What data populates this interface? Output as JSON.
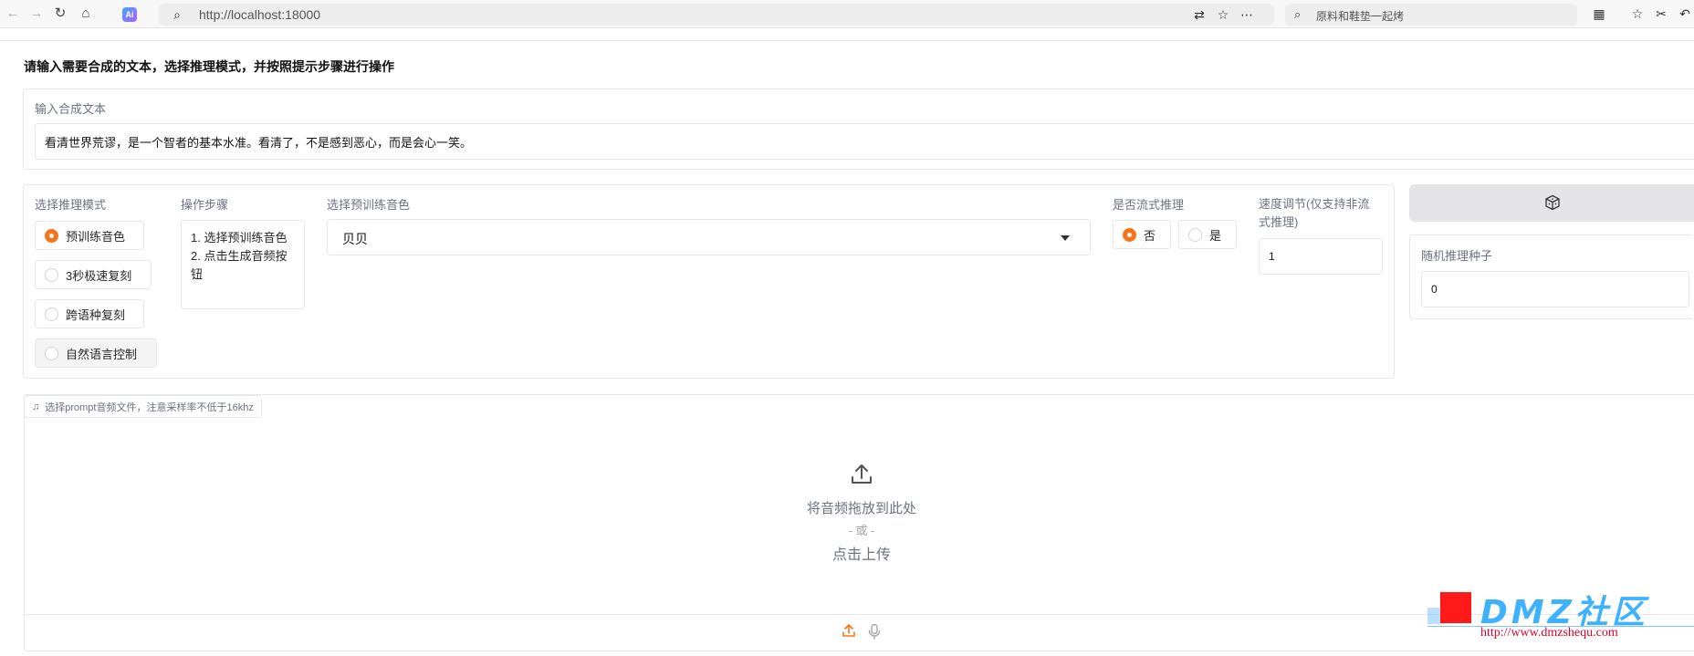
{
  "browser": {
    "url": "http://localhost:18000",
    "search_query": "原料和鞋垫一起烤",
    "ai_badge": "Ai"
  },
  "page": {
    "heading": "请输入需要合成的文本，选择推理模式，并按照提示步骤进行操作"
  },
  "tts_input": {
    "label": "输入合成文本",
    "value": "看清世界荒谬，是一个智者的基本水准。看清了，不是感到恶心，而是会心一笑。"
  },
  "mode": {
    "label": "选择推理模式",
    "options": [
      "预训练音色",
      "3秒极速复刻",
      "跨语种复刻",
      "自然语言控制"
    ],
    "selected": "预训练音色"
  },
  "steps": {
    "label": "操作步骤",
    "lines": [
      "1. 选择预训练音色",
      "2. 点击生成音频按",
      "钮"
    ]
  },
  "voice": {
    "label": "选择预训练音色",
    "selected": "贝贝"
  },
  "stream": {
    "label": "是否流式推理",
    "options": [
      "否",
      "是"
    ],
    "selected": "否"
  },
  "speed": {
    "label_line1": "速度调节(仅支持非流",
    "label_line2": "式推理)",
    "value": "1"
  },
  "seed": {
    "label": "随机推理种子",
    "value": "0",
    "dice_icon": "dice-icon"
  },
  "prompt_audio": {
    "label": "选择prompt音频文件，注意采样率不低于16khz",
    "drop_text": "将音频拖放到此处",
    "or_text": "- 或 -",
    "click_text": "点击上传"
  },
  "watermark": {
    "title": "DMZ社区",
    "url": "http://www.dmzshequ.com"
  },
  "colors": {
    "accent": "#f97316",
    "border": "#e5e7eb",
    "label": "#6b7280"
  }
}
